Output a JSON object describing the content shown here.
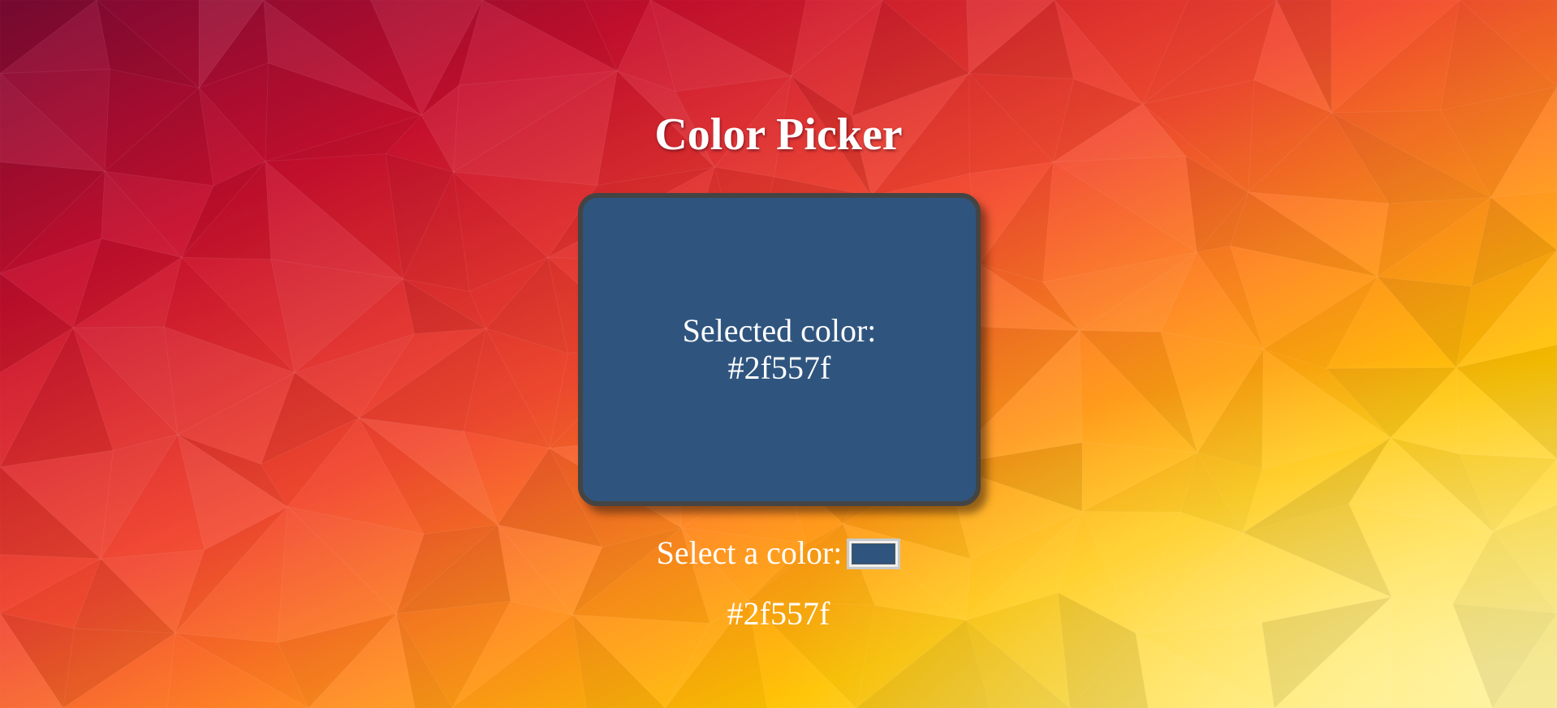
{
  "page": {
    "title": "Color Picker"
  },
  "preview": {
    "label": "Selected color:",
    "hex": "#2f557f",
    "color": "#2f557f"
  },
  "picker": {
    "label": "Select a color:",
    "value": "#2f557f"
  },
  "readout": {
    "hex": "#2f557f"
  },
  "background": {
    "colors": [
      "#7e0a35",
      "#c8102e",
      "#f34a30",
      "#ff8a1e",
      "#ffc400",
      "#ffe14a",
      "#fff08a"
    ]
  }
}
